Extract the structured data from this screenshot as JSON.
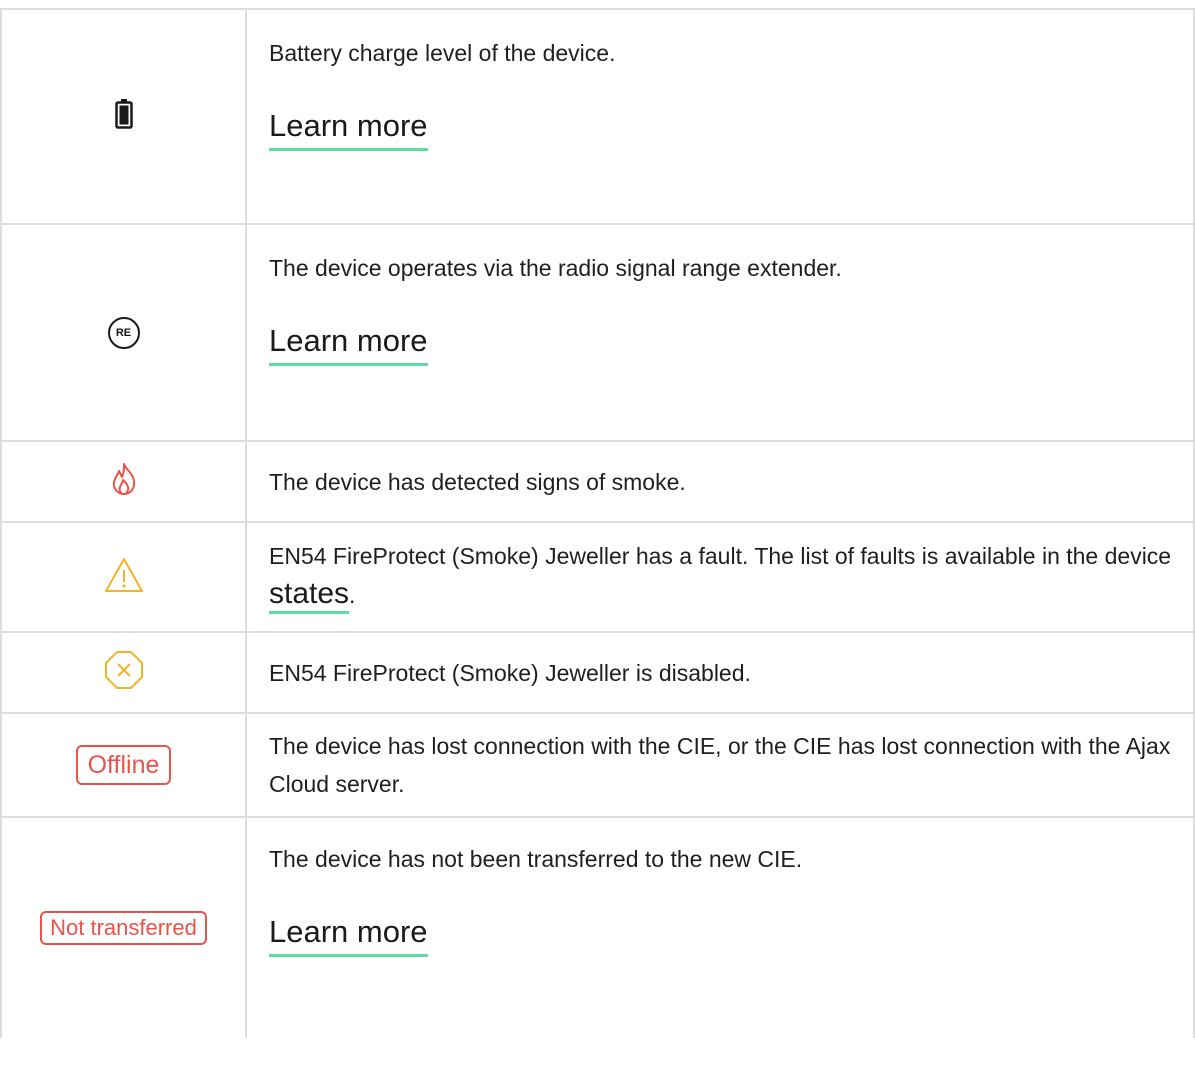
{
  "rows": [
    {
      "icon": "battery-icon",
      "description": "Battery charge level of the device.",
      "link": "Learn more"
    },
    {
      "icon": "re-icon",
      "icon_text": "RE",
      "description": "The device operates via the radio signal range extender.",
      "link": "Learn more"
    },
    {
      "icon": "fire-icon",
      "description": "The device has detected signs of smoke."
    },
    {
      "icon": "warning-icon",
      "description_before": "EN54 FireProtect (Smoke) Jeweller has a fault. The list of faults is available in the device ",
      "inline_link": "states",
      "description_after": "."
    },
    {
      "icon": "disabled-icon",
      "description": "EN54 FireProtect (Smoke) Jeweller is disabled."
    },
    {
      "badge": "Offline",
      "description": "The device has lost connection with the CIE, or the CIE has lost connection with the Ajax Cloud server."
    },
    {
      "badge": "Not transferred",
      "description": "The device has not been transferred to the new CIE.",
      "link": "Learn more"
    }
  ],
  "colors": {
    "link_underline": "#5fdca0",
    "alert_red": "#e8544a",
    "warning_amber": "#f0b429",
    "border": "#dcdcdc"
  }
}
